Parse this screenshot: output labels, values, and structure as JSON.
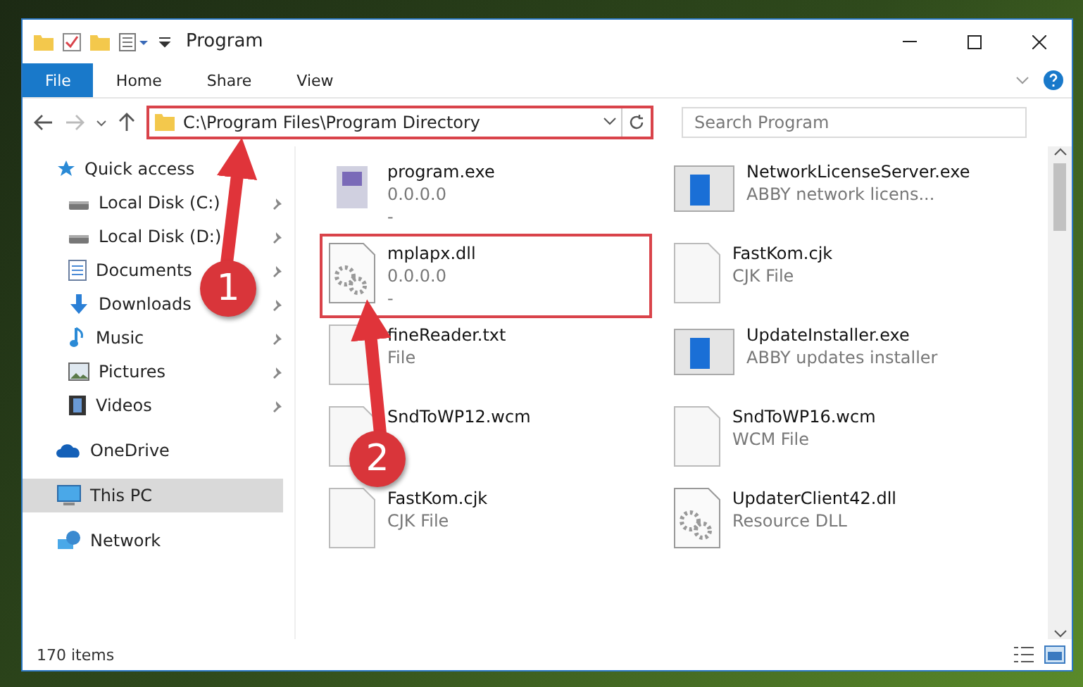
{
  "window": {
    "title": "Program"
  },
  "ribbon_tabs": [
    {
      "label": "File",
      "kind": "file"
    },
    {
      "label": "Home",
      "kind": "tab"
    },
    {
      "label": "Share",
      "kind": "tab"
    },
    {
      "label": "View",
      "kind": "tab"
    }
  ],
  "address_bar": {
    "path": "C:\\Program Files\\Program Directory",
    "highlighted": true
  },
  "search": {
    "placeholder": "Search Program"
  },
  "sidebar": {
    "items": [
      {
        "label": "Quick access",
        "kind": "star",
        "selected": false,
        "pinned": false,
        "children": [
          {
            "label": "Local Disk (C:)",
            "kind": "disk",
            "selected": false,
            "pinned": true
          },
          {
            "label": "Local Disk (D:)",
            "kind": "disk",
            "selected": false,
            "pinned": true
          },
          {
            "label": "Documents",
            "kind": "doc",
            "selected": false,
            "pinned": true
          },
          {
            "label": "Downloads",
            "kind": "download",
            "selected": false,
            "pinned": true
          },
          {
            "label": "Music",
            "kind": "music",
            "selected": false,
            "pinned": true
          },
          {
            "label": "Pictures",
            "kind": "picture",
            "selected": false,
            "pinned": true
          },
          {
            "label": "Videos",
            "kind": "video",
            "selected": false,
            "pinned": true
          }
        ]
      },
      {
        "label": "OneDrive",
        "kind": "cloud",
        "selected": false,
        "pinned": false
      },
      {
        "label": "This PC",
        "kind": "pc",
        "selected": true,
        "pinned": false
      },
      {
        "label": "Network",
        "kind": "network",
        "selected": false,
        "pinned": false
      }
    ]
  },
  "files": [
    {
      "name": "program.exe",
      "line_2": "0.0.0.0",
      "line_3": "-",
      "kind": "exe",
      "highlighted": false
    },
    {
      "name": "NetworkLicenseServer.exe",
      "line_2": "ABBY network licens...",
      "kind": "app",
      "highlighted": false
    },
    {
      "name": "mplapx.dll",
      "line_2": "0.0.0.0",
      "line_3": "-",
      "kind": "dll",
      "highlighted": true
    },
    {
      "name": "FastKom.cjk",
      "line_2": "CJK File",
      "kind": "file",
      "highlighted": false
    },
    {
      "name": "fineReader.txt",
      "line_2": "File",
      "kind": "file",
      "highlighted": false
    },
    {
      "name": "UpdateInstaller.exe",
      "line_2": "ABBY updates installer",
      "kind": "app",
      "highlighted": false
    },
    {
      "name": "SndToWP12.wcm",
      "kind": "file",
      "highlighted": false
    },
    {
      "name": "SndToWP16.wcm",
      "line_2": "WCM File",
      "kind": "file",
      "highlighted": false
    },
    {
      "name": "FastKom.cjk",
      "line_2": "CJK File",
      "kind": "file",
      "highlighted": false
    },
    {
      "name": "UpdaterClient42.dll",
      "line_2": "Resource DLL",
      "kind": "dll",
      "highlighted": false
    }
  ],
  "status_bar": {
    "item_count": "170 items"
  },
  "annotations": [
    {
      "number": "1"
    },
    {
      "number": "2"
    }
  ]
}
